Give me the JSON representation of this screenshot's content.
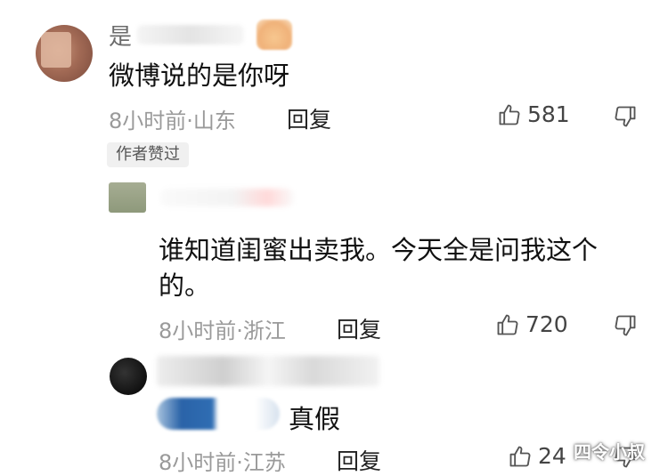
{
  "comments": [
    {
      "username_first_char": "是",
      "text": "微博说的是你呀",
      "time_location": "8小时前·山东",
      "reply_label": "回复",
      "likes": "581",
      "author_tag": "作者赞过"
    },
    {
      "text_line1": "谁知道闺蜜出卖我。今天全是问我这个",
      "text_line2": "的。",
      "time_location": "8小时前·浙江",
      "reply_label": "回复",
      "likes": "720"
    },
    {
      "text_visible": "真假",
      "time_location": "8小时前·江苏",
      "reply_label": "回复",
      "likes": "24"
    }
  ],
  "watermark": "四令小叔",
  "icons": {
    "like": "thumbs-up-icon",
    "dislike": "thumbs-down-icon"
  }
}
